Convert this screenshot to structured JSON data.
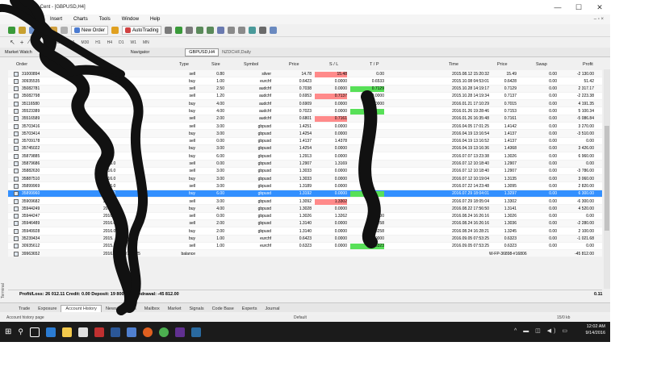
{
  "window": {
    "title": "Broker-Cent - [GBPUSD,H4]",
    "min": "—",
    "max": "☐",
    "close": "✕"
  },
  "menu": {
    "items": [
      "Insert",
      "Charts",
      "Tools",
      "Window",
      "Help"
    ],
    "mdi_controls": "– ▫ ×"
  },
  "toolbar": {
    "new_order": "New Order",
    "autotrading": "AutoTrading"
  },
  "timeframes": [
    "M1",
    "M5",
    "M15",
    "M30",
    "H1",
    "H4",
    "D1",
    "W1",
    "MN"
  ],
  "panels": {
    "market_watch": "Market Watch",
    "navigator": "Navigator",
    "chart_tab_active": "GBPUSD,H4",
    "chart_tab_2": "NZDCHF,Daily"
  },
  "headers": {
    "order": "Order",
    "type": "Type",
    "size": "Size",
    "symbol": "Symbol",
    "price": "Price",
    "sl": "S / L",
    "tp": "T / P",
    "time": "Time",
    "price2": "Price",
    "swap": "Swap",
    "profit": "Profit"
  },
  "rows": [
    {
      "order": "31000894",
      "time": "",
      "type": "sell",
      "size": "0.80",
      "symbol": "silver",
      "price": "14.78",
      "sl": "15.48",
      "tp": "0.00",
      "ctime": "2015.08.12 15:20:32",
      "cprice": "15.49",
      "swap": "0.00",
      "profit": "-2 130.00",
      "sl_hl": "red",
      "tp_hl": "",
      "sel": false
    },
    {
      "order": "30935535",
      "time": "",
      "type": "buy",
      "size": "1.00",
      "symbol": "eurchf",
      "price": "0.6423",
      "sl": "0.0000",
      "tp": "0.6533",
      "ctime": "2015.10.08 04:53:01",
      "cprice": "0.6428",
      "swap": "0.00",
      "profit": "51.42",
      "sl_hl": "",
      "tp_hl": "",
      "sel": false
    },
    {
      "order": "35082781",
      "time": "",
      "type": "sell",
      "size": "2.50",
      "symbol": "audchf",
      "price": "0.7038",
      "sl": "0.0000",
      "tp": "0.7129",
      "ctime": "2015.10.28 14:19:17",
      "cprice": "0.7129",
      "swap": "0.00",
      "profit": "2 317.17",
      "sl_hl": "",
      "tp_hl": "green",
      "sel": false
    },
    {
      "order": "35082798",
      "time": "",
      "type": "sell",
      "size": "1.20",
      "symbol": "audchf",
      "price": "0.6953",
      "sl": "0.7137",
      "tp": "0.0000",
      "ctime": "2015.10.28 14:19:34",
      "cprice": "0.7137",
      "swap": "0.00",
      "profit": "-2 223.38",
      "sl_hl": "red",
      "tp_hl": "",
      "sel": false
    },
    {
      "order": "35116580",
      "time": "",
      "type": "buy",
      "size": "4.00",
      "symbol": "audchf",
      "price": "0.6909",
      "sl": "0.0000",
      "tp": "0.0000",
      "ctime": "2016.01.21 17:10:29",
      "cprice": "0.7015",
      "swap": "0.00",
      "profit": "4 191.35",
      "sl_hl": "",
      "tp_hl": "",
      "sel": false
    },
    {
      "order": "35523389",
      "time": "",
      "type": "buy",
      "size": "4.00",
      "symbol": "audchf",
      "price": "0.7023",
      "sl": "0.0000",
      "tp": "",
      "ctime": "2016.01.26 19:28:46",
      "cprice": "0.7153",
      "swap": "0.00",
      "profit": "5 100.34",
      "sl_hl": "",
      "tp_hl": "green",
      "sel": false
    },
    {
      "order": "35516589",
      "time": "",
      "type": "sell",
      "size": "2.00",
      "symbol": "audchf",
      "price": "0.6801",
      "sl": "0.7161",
      "tp": "",
      "ctime": "2016.01.26 16:35:48",
      "cprice": "0.7161",
      "swap": "0.00",
      "profit": "-5 086.84",
      "sl_hl": "red",
      "tp_hl": "",
      "sel": false
    },
    {
      "order": "35703416",
      "time": "",
      "type": "sell",
      "size": "3.00",
      "symbol": "gbpusd",
      "price": "1.4251",
      "sl": "0.0000",
      "tp": "",
      "ctime": "2016.04.05 17:01:25",
      "cprice": "1.4142",
      "swap": "0.00",
      "profit": "3 270.00",
      "sl_hl": "",
      "tp_hl": "",
      "sel": false
    },
    {
      "order": "35703414",
      "time": "",
      "type": "buy",
      "size": "3.00",
      "symbol": "gbpusd",
      "price": "1.4254",
      "sl": "0.0000",
      "tp": "",
      "ctime": "2016.04.19 13:16:54",
      "cprice": "1.4137",
      "swap": "0.00",
      "profit": "-3 510.00",
      "sl_hl": "",
      "tp_hl": "",
      "sel": false
    },
    {
      "order": "35709178",
      "time": "",
      "type": "sell",
      "size": "0.00",
      "symbol": "gbpusd",
      "price": "1.4137",
      "sl": "1.4378",
      "tp": "",
      "ctime": "2016.04.19 13:16:52",
      "cprice": "1.4137",
      "swap": "0.00",
      "profit": "0.00",
      "sl_hl": "",
      "tp_hl": "",
      "sel": false
    },
    {
      "order": "35745022",
      "time": "",
      "type": "buy",
      "size": "3.00",
      "symbol": "gbpusd",
      "price": "1.4254",
      "sl": "0.0000",
      "tp": "",
      "ctime": "2016.04.19 13:16:36",
      "cprice": "1.4368",
      "swap": "0.00",
      "profit": "3 426.00",
      "sl_hl": "",
      "tp_hl": "",
      "sel": false
    },
    {
      "order": "35879885",
      "time": "",
      "type": "buy",
      "size": "6.00",
      "symbol": "gbpusd",
      "price": "1.2913",
      "sl": "0.0000",
      "tp": "",
      "ctime": "2016.07.07 13:23:38",
      "cprice": "1.3026",
      "swap": "0.00",
      "profit": "6 960.00",
      "sl_hl": "",
      "tp_hl": "",
      "sel": false
    },
    {
      "order": "35879686",
      "time": "2016.0",
      "type": "sell",
      "size": "0.00",
      "symbol": "gbpusd",
      "price": "1.2907",
      "sl": "1.3169",
      "tp": "",
      "ctime": "2016.07.12 10:18:40",
      "cprice": "1.2907",
      "swap": "0.00",
      "profit": "0.00",
      "sl_hl": "",
      "tp_hl": "",
      "sel": false
    },
    {
      "order": "35882630",
      "time": "2016.0",
      "type": "sell",
      "size": "3.00",
      "symbol": "gbpusd",
      "price": "1.3033",
      "sl": "0.0000",
      "tp": "",
      "ctime": "2016.07.12 10:18:40",
      "cprice": "1.2907",
      "swap": "0.00",
      "profit": "-3 786.00",
      "sl_hl": "",
      "tp_hl": "",
      "sel": false
    },
    {
      "order": "35887510",
      "time": "2016.0",
      "type": "buy",
      "size": "3.00",
      "symbol": "gbpusd",
      "price": "1.3033",
      "sl": "0.0000",
      "tp": "",
      "ctime": "2016.07.12 10:19:04",
      "cprice": "1.3135",
      "swap": "0.00",
      "profit": "3 060.00",
      "sl_hl": "",
      "tp_hl": "",
      "sel": false
    },
    {
      "order": "35899969",
      "time": "2016.0",
      "type": "sell",
      "size": "3.00",
      "symbol": "gbpusd",
      "price": "1.3189",
      "sl": "0.0000",
      "tp": "",
      "ctime": "2016.07.22 14:23:48",
      "cprice": "1.3095",
      "swap": "0.00",
      "profit": "2 820.00",
      "sl_hl": "",
      "tp_hl": "",
      "sel": false
    },
    {
      "order": "35899960",
      "time": "2016.0",
      "type": "buy",
      "size": "6.00",
      "symbol": "gbpusd",
      "price": "1.3192",
      "sl": "0.0000",
      "tp": "",
      "ctime": "2016.07.29 18:04:01",
      "cprice": "1.3297",
      "swap": "0.00",
      "profit": "6 300.00",
      "sl_hl": "",
      "tp_hl": "green",
      "sel": true
    },
    {
      "order": "35909682",
      "time": "2016.0",
      "type": "sell",
      "size": "3.00",
      "symbol": "gbpusd",
      "price": "1.3092",
      "sl": "1.3302",
      "tp": "",
      "ctime": "2016.07.29 18:05:04",
      "cprice": "1.3302",
      "swap": "0.00",
      "profit": "-6 300.00",
      "sl_hl": "red",
      "tp_hl": "",
      "sel": false
    },
    {
      "order": "35944249",
      "time": "2016.0",
      "type": "buy",
      "size": "4.00",
      "symbol": "gbpusd",
      "price": "1.3028",
      "sl": "0.0000",
      "tp": "",
      "ctime": "2016.08.22 17:56:50",
      "cprice": "1.3141",
      "swap": "0.00",
      "profit": "4 520.00",
      "sl_hl": "",
      "tp_hl": "",
      "sel": false
    },
    {
      "order": "35944247",
      "time": "2016.0",
      "type": "sell",
      "size": "0.00",
      "symbol": "gbpusd",
      "price": "1.3026",
      "sl": "1.3262",
      "tp": "0.0000",
      "ctime": "2016.08.24 16:26:16",
      "cprice": "1.3026",
      "swap": "0.00",
      "profit": "0.00",
      "sl_hl": "",
      "tp_hl": "",
      "sel": false
    },
    {
      "order": "35946489",
      "time": "2016.0",
      "type": "sell",
      "size": "2.00",
      "symbol": "gbpusd",
      "price": "1.3140",
      "sl": "0.0000",
      "tp": "1.3258",
      "ctime": "2016.08.24 16:26:16",
      "cprice": "1.3036",
      "swap": "0.00",
      "profit": "-2 280.00",
      "sl_hl": "",
      "tp_hl": "",
      "sel": false
    },
    {
      "order": "35949928",
      "time": "2016.0",
      "type": "buy",
      "size": "2.00",
      "symbol": "gbpusd",
      "price": "1.3140",
      "sl": "0.0000",
      "tp": "1.3258",
      "ctime": "2016.08.24 16:28:21",
      "cprice": "1.3245",
      "swap": "0.00",
      "profit": "2 100.00",
      "sl_hl": "",
      "tp_hl": "",
      "sel": false
    },
    {
      "order": "35239434",
      "time": "2015.",
      "type": "buy",
      "size": "1.00",
      "symbol": "eurchf",
      "price": "0.6423",
      "sl": "0.0000",
      "tp": "0.0000",
      "ctime": "2016.09.05 07:53:25",
      "cprice": "0.6323",
      "swap": "0.00",
      "profit": "-1 021.68",
      "sl_hl": "",
      "tp_hl": "",
      "sel": false
    },
    {
      "order": "30935612",
      "time": "2015.1",
      "type": "sell",
      "size": "1.00",
      "symbol": "eurchf",
      "price": "0.6323",
      "sl": "0.0000",
      "tp": "0.6323",
      "ctime": "2016.09.05 07:53:25",
      "cprice": "0.6323",
      "swap": "0.00",
      "profit": "0.00",
      "sl_hl": "",
      "tp_hl": "green",
      "sel": false
    },
    {
      "order": "39963652",
      "time": "2016.09.05 07:54:25",
      "type": "balance",
      "size": "",
      "symbol": "",
      "price": "",
      "sl": "",
      "tp": "",
      "ctime": "",
      "cprice": "W-FP-36898-#16806",
      "swap": "",
      "profit": "-45 812.00",
      "sl_hl": "",
      "tp_hl": "",
      "sel": false
    }
  ],
  "summary": {
    "text": "Profit/Loss: 26 012.11  Credit: 0.00  Deposit: 19 800.00  Withdrawal: -45 812.00",
    "total": "0.11"
  },
  "bottom_tabs": [
    "Trade",
    "Exposure",
    "Account History",
    "News",
    "Alerts",
    "Mailbox",
    "Market",
    "Signals",
    "Code Base",
    "Experts",
    "Journal"
  ],
  "active_tab": "Account History",
  "status": {
    "left": "Account history page",
    "mid": "Default",
    "right": "15/0 kb"
  },
  "terminal_label": "Terminal",
  "taskbar": {
    "time": "12:02 AM",
    "date": "9/14/2016",
    "tray": "^ ▬ ◫ ◀) ▭"
  },
  "colors": {
    "selection": "#3390ff",
    "sl_red": "#ff8a8a",
    "tp_green": "#58e058",
    "taskbar": "#1b1b1b"
  }
}
